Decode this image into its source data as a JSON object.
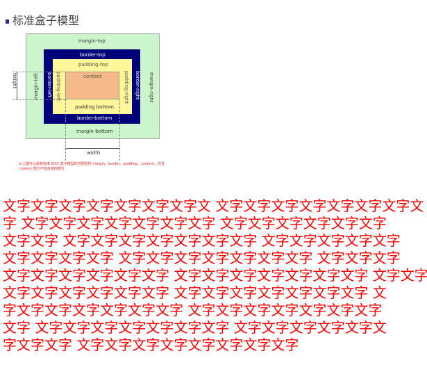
{
  "figure": {
    "title": "标准盒子模型",
    "labels": {
      "margin_top": "margin-top",
      "border_top": "border-top",
      "padding_top": "padding-top",
      "content": "content",
      "padding_bottom": "padding bottom",
      "border_bottom": "border-bottom",
      "margin_bottom": "margin-bottom",
      "margin_left": "margin-left",
      "border_left": "border-left",
      "padding_left": "padding-left",
      "padding_right": "padding-right",
      "border_right": "border-right",
      "margin_right": "margin-right",
      "height": "height",
      "width": "width"
    },
    "caption": "从上图可以看到标准 W3C 盒子模型的范围包括 margin、border、padding、content，并且 content 部分不包含其他部分",
    "colors": {
      "margin": "#ccf5cc",
      "border": "#00007a",
      "padding": "#fff59a",
      "content": "#f5b98a"
    }
  },
  "text_lines": [
    "文字文字文字文字文字文字文字文 文字文字文字文字文字文字文字文",
    "字 文字文字文字文字文字文字文字 文字文字文字文字文字文字",
    "文字文字 文字文字文字文字文字文字文字 文字文字文字文字文字",
    "文字文字文字文字 文字文字文字文字文字文字文字 文字文字文字",
    "文字文字文字文字文字文字 文字文字文字文字文字文字文字 文字文字",
    "文字文字文字文字文字文字 文字文字文字文字文字文字文字 文",
    "字文字文字文字文字文字文字 文字文字文字文字文字文字文字",
    "文字 文字文字文字文字文字文字文字 文字文字文字文字文字文",
    "字文字文字 文字文字文字文字文字文字文字文字"
  ]
}
